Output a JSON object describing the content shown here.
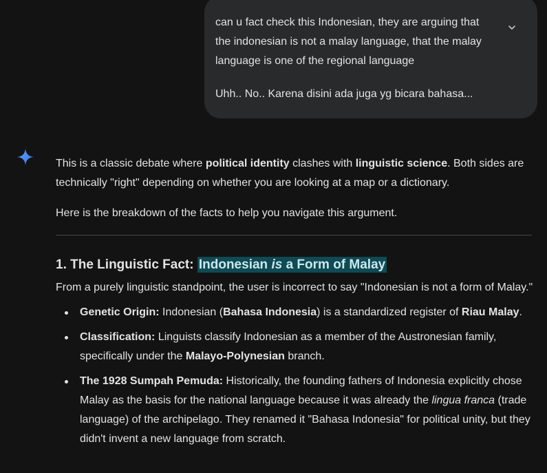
{
  "user_message": {
    "lines": [
      "can u fact check this Indonesian, they are arguing that",
      "the indonesian is not a malay language, that the malay",
      "language is one of the regional language"
    ],
    "preview_line": "Uhh.. No.. Karena disini ada juga yg bicara bahasa...",
    "expand_icon": "chevron-down-icon"
  },
  "response": {
    "p1": {
      "t1": "This is a classic debate where ",
      "b1": "political identity",
      "t2": " clashes with ",
      "b2": "linguistic science",
      "t3": ". Both sides are technically \"right\" depending on whether you are looking at a map or a dictionary."
    },
    "p2": "Here is the breakdown of the facts to help you navigate this argument.",
    "section1": {
      "heading_prefix": "1. The Linguistic Fact: ",
      "heading_hl_a": "Indonesian ",
      "heading_hl_em": "is",
      "heading_hl_b": " a Form of Malay",
      "intro": "From a purely linguistic standpoint, the user is incorrect to say \"Indonesian is not a form of Malay.\"",
      "bullets": [
        {
          "label": "Genetic Origin:",
          "t1": " Indonesian (",
          "b1": "Bahasa Indonesia",
          "t2": ") is a standardized register of ",
          "b2": "Riau Malay",
          "t3": "."
        },
        {
          "label": "Classification:",
          "t1": " Linguists classify Indonesian as a member of the Austronesian family, specifically under the ",
          "b1": "Malayo-Polynesian",
          "t2": " branch."
        },
        {
          "label": "The 1928 Sumpah Pemuda:",
          "t1": " Historically, the founding fathers of Indonesia explicitly chose Malay as the basis for the national language because it was already the ",
          "em1": "lingua franca",
          "t2": " (trade language) of the archipelago. They renamed it \"Bahasa Indonesia\" for political unity, but they didn't invent a new language from scratch."
        }
      ]
    }
  },
  "colors": {
    "background": "#131314",
    "bubble": "#282a2c",
    "highlight": "#104a54",
    "spark_blue": "#4a8af4"
  }
}
